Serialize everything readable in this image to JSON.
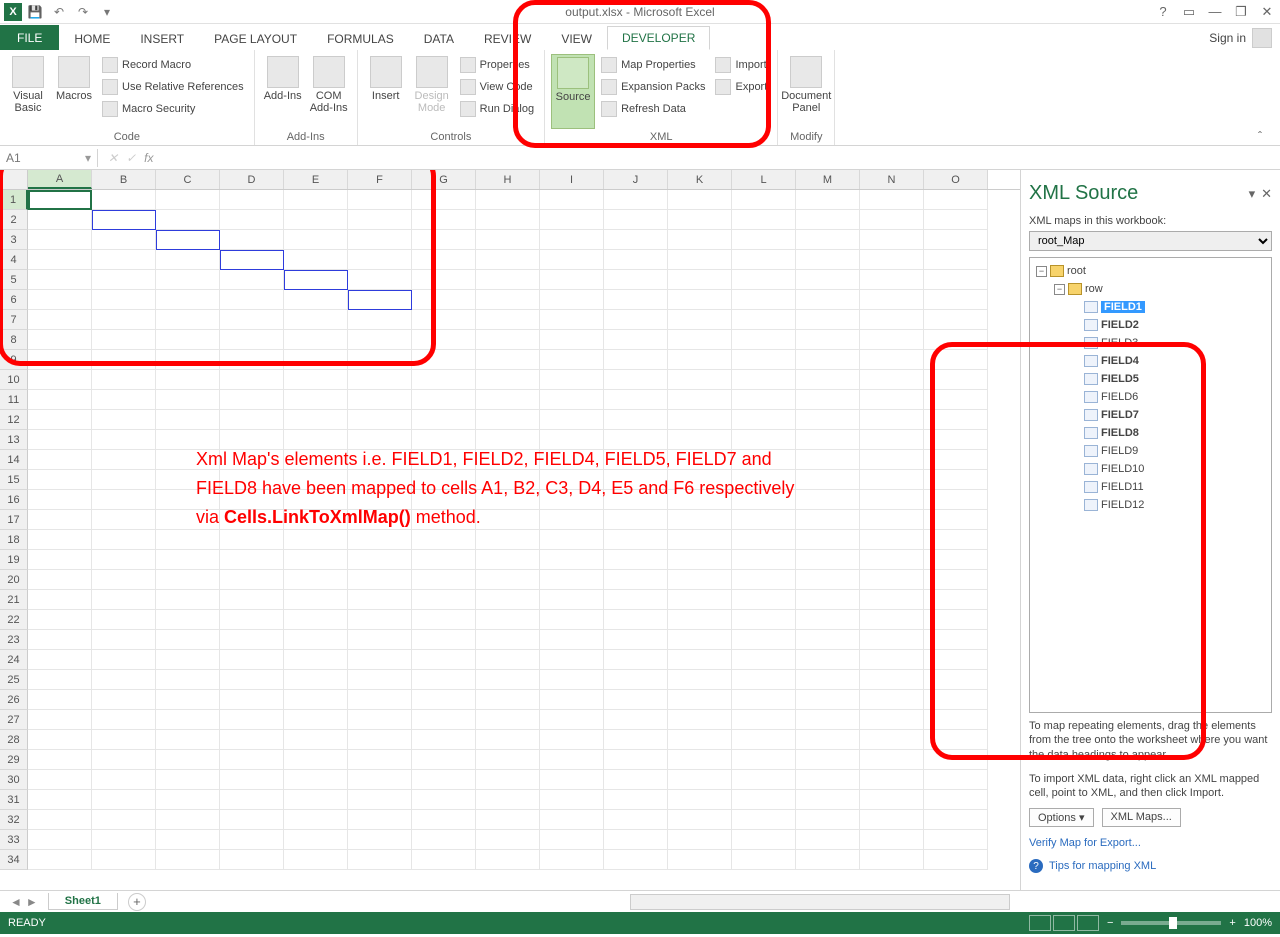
{
  "title": "output.xlsx - Microsoft Excel",
  "signin": "Sign in",
  "tabs": {
    "file": "FILE",
    "home": "HOME",
    "insert": "INSERT",
    "pagelayout": "PAGE LAYOUT",
    "formulas": "FORMULAS",
    "data": "DATA",
    "review": "REVIEW",
    "view": "VIEW",
    "developer": "DEVELOPER"
  },
  "ribbon": {
    "code": {
      "label": "Code",
      "visualbasic": "Visual Basic",
      "macros": "Macros",
      "record": "Record Macro",
      "userel": "Use Relative References",
      "security": "Macro Security"
    },
    "addins": {
      "label": "Add-Ins",
      "addins": "Add-Ins",
      "com": "COM Add-Ins"
    },
    "controls": {
      "label": "Controls",
      "insert": "Insert",
      "design": "Design Mode",
      "props": "Properties",
      "viewcode": "View Code",
      "rundlg": "Run Dialog"
    },
    "xml": {
      "label": "XML",
      "source": "Source",
      "mapprops": "Map Properties",
      "exp": "Expansion Packs",
      "refresh": "Refresh Data",
      "import": "Import",
      "export": "Export"
    },
    "modify": {
      "label": "Modify",
      "docpanel": "Document Panel"
    }
  },
  "namebox": "A1",
  "cols": [
    "A",
    "B",
    "C",
    "D",
    "E",
    "F",
    "G",
    "H",
    "I",
    "J",
    "K",
    "L",
    "M",
    "N",
    "O"
  ],
  "mapped_cells": [
    "A1",
    "B2",
    "C3",
    "D4",
    "E5",
    "F6"
  ],
  "annotation": {
    "l1": "Xml Map's elements i.e. FIELD1, FIELD2, FIELD4, FIELD5, FIELD7 and",
    "l2": "FIELD8 have been mapped to cells A1, B2, C3, D4, E5 and F6 respectively",
    "l3a": "via ",
    "l3b": "Cells.LinkToXmlMap()",
    "l3c": " method."
  },
  "xmlpane": {
    "title": "XML Source",
    "mapslabel": "XML maps in this workbook:",
    "selected": "root_Map",
    "root": "root",
    "row": "row",
    "fields": [
      {
        "name": "FIELD1",
        "bold": true,
        "sel": true
      },
      {
        "name": "FIELD2",
        "bold": true
      },
      {
        "name": "FIELD3",
        "bold": false
      },
      {
        "name": "FIELD4",
        "bold": true
      },
      {
        "name": "FIELD5",
        "bold": true
      },
      {
        "name": "FIELD6",
        "bold": false
      },
      {
        "name": "FIELD7",
        "bold": true
      },
      {
        "name": "FIELD8",
        "bold": true
      },
      {
        "name": "FIELD9",
        "bold": false
      },
      {
        "name": "FIELD10",
        "bold": false
      },
      {
        "name": "FIELD11",
        "bold": false
      },
      {
        "name": "FIELD12",
        "bold": false
      }
    ],
    "help1": "To map repeating elements, drag the elements from the tree onto the worksheet where you want the data headings to appear.",
    "help2": "To import XML data, right click an XML mapped cell, point to XML, and then click Import.",
    "options": "Options ▾",
    "xmlmaps": "XML Maps...",
    "verify": "Verify Map for Export...",
    "tips": "Tips for mapping XML"
  },
  "sheet": "Sheet1",
  "status": "READY",
  "zoom": "100%"
}
